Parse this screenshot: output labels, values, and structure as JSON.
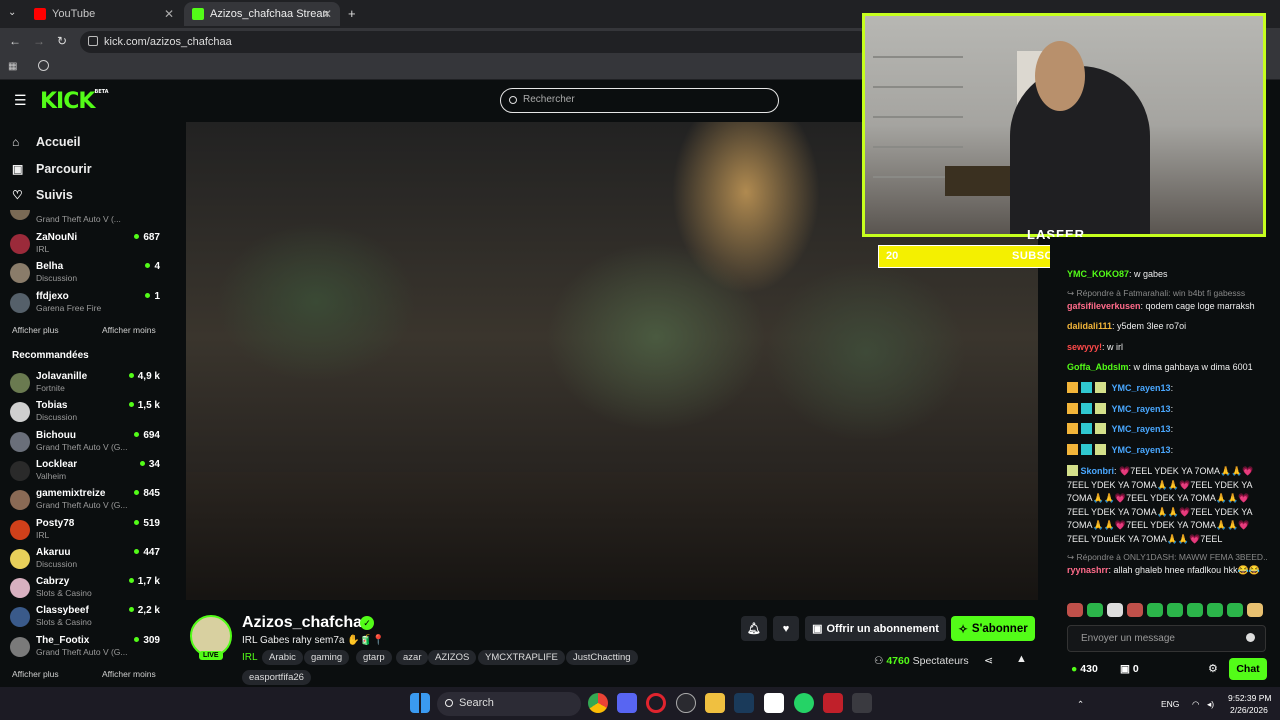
{
  "browser": {
    "tabs": [
      {
        "title": "YouTube",
        "close": "✕",
        "color": "#ff0000"
      },
      {
        "title": "Azizos_chafchaa Stream - Watc",
        "close": "✕",
        "color": "#53fc18"
      }
    ],
    "new_tab": "+",
    "url": "kick.com/azizos_chafchaa"
  },
  "header": {
    "logo": "KICK",
    "logo_badge": "BETA",
    "search_placeholder": "Rechercher"
  },
  "nav": [
    {
      "label": "Accueil",
      "icon": "home-icon",
      "glyph": "⌂"
    },
    {
      "label": "Parcourir",
      "icon": "browse-icon",
      "glyph": "▣"
    },
    {
      "label": "Suivis",
      "icon": "heart-icon",
      "glyph": "♡"
    }
  ],
  "followed_partial": "Grand Theft Auto V (...",
  "followed": [
    {
      "name": "ZaNouNi",
      "category": "IRL",
      "viewers": "687",
      "color": "#9b2a3a"
    },
    {
      "name": "Belha",
      "category": "Discussion",
      "viewers": "4",
      "color": "#8a7c6a"
    },
    {
      "name": "ffdjexo",
      "category": "Garena Free Fire",
      "viewers": "1",
      "color": "#55606a"
    }
  ],
  "followed_show_more": "Afficher plus",
  "followed_show_less": "Afficher moins",
  "recommended_heading": "Recommandées",
  "recommended": [
    {
      "name": "Jolavanille",
      "category": "Fortnite",
      "viewers": "4,9 k",
      "color": "#6a7a50"
    },
    {
      "name": "Tobias",
      "category": "Discussion",
      "viewers": "1,5 k",
      "color": "#cfcfcf"
    },
    {
      "name": "Bichouu",
      "category": "Grand Theft Auto V (G...",
      "viewers": "694",
      "color": "#6a6f7a"
    },
    {
      "name": "Locklear",
      "category": "Valheim",
      "viewers": "34",
      "color": "#2a2a2a"
    },
    {
      "name": "gamemixtreize",
      "category": "Grand Theft Auto V (G...",
      "viewers": "845",
      "color": "#8a6a55"
    },
    {
      "name": "Posty78",
      "category": "IRL",
      "viewers": "519",
      "color": "#d0401a"
    },
    {
      "name": "Akaruu",
      "category": "Discussion",
      "viewers": "447",
      "color": "#e8d05a"
    },
    {
      "name": "Cabrzy",
      "category": "Slots & Casino",
      "viewers": "1,7 k",
      "color": "#d8b0c0"
    },
    {
      "name": "Classybeef",
      "category": "Slots & Casino",
      "viewers": "2,2 k",
      "color": "#3a5a8a"
    },
    {
      "name": "The_Footix",
      "category": "Grand Theft Auto V (G...",
      "viewers": "309",
      "color": "#7a7a7a"
    }
  ],
  "rec_show_more": "Afficher plus",
  "rec_show_less": "Afficher moins",
  "stream": {
    "streamer": "Azizos_chafchaa",
    "live_badge": "LIVE",
    "title": "IRL Gabes rahy sem7a ✋🧃📍",
    "category": "IRL",
    "tags": [
      "Arabic",
      "gaming",
      "gtarp",
      "azar",
      "AZIZOS",
      "YMCXTRAPLIFE",
      "JustChactting",
      "easportfifa26"
    ],
    "gift_label": "Offrir un abonnement",
    "subscribe_label": "S'abonner",
    "viewers_count": "4760",
    "viewers_label": "Spectateurs"
  },
  "overlay": {
    "brand": "LASFER",
    "sub_label": "SUBSCRIBERS",
    "sub_current": "20",
    "sub_goal": "25",
    "sub_progress": 0.79
  },
  "chat": {
    "messages": [
      {
        "user": "YMC_KOKO87",
        "color": "#53fc18",
        "text": ": w gabes"
      },
      {
        "reply": "↪ Répondre à Fatmarahali: win b4bt fi gabesss"
      },
      {
        "user": "gafsifileverkusen",
        "color": "#ff6b8a",
        "text": ": qodem cage loge marraksh"
      },
      {
        "user": "dalidali111",
        "color": "#f3b53a",
        "text": ": y5dem 3lee ro7oi"
      },
      {
        "user": "sewyyy!",
        "color": "#ff4a4a",
        "text": ": w irl"
      },
      {
        "user": "Goffa_Abdslm",
        "color": "#53fc18",
        "text": ": w dima gahbaya w dima 6001"
      },
      {
        "user": "YMC_rayen13",
        "color": "#4aa8ff",
        "text": ":"
      },
      {
        "user": "YMC_rayen13",
        "color": "#4aa8ff",
        "text": ":"
      },
      {
        "user": "YMC_rayen13",
        "color": "#4aa8ff",
        "text": ":"
      },
      {
        "user": "YMC_rayen13",
        "color": "#4aa8ff",
        "text": ":"
      },
      {
        "user": "Skonbri",
        "color": "#4aa8ff",
        "text": ": 💗7EEL YDEK YA 7OMA🙏🙏💗7EEL YDEK YA 7OMA🙏🙏💗7EEL YDEK YA 7OMA🙏🙏💗7EEL YDEK YA 7OMA🙏🙏💗7EEL YDEK YA 7OMA🙏🙏💗7EEL YDEK YA 7OMA🙏🙏💗7EEL YDEK YA 7OMA🙏🙏💗7EEL YDuuEK YA 7OMA🙏🙏💗7EEL"
      },
      {
        "reply": "↪ Répondre à ONLY1DASH: MAWW FEMA 3BEED..."
      },
      {
        "user": "ryynashrr",
        "color": "#ff6b8a",
        "text": ": allah ghaleb hnee nfadlkou hkk😂😂"
      }
    ],
    "input_placeholder": "Envoyer un message",
    "points": "430",
    "gifts_count": "0",
    "chat_button": "Chat"
  },
  "taskbar": {
    "search": "Search",
    "lang": "ENG",
    "time": "9:52:39 PM",
    "date": "2/26/2026"
  }
}
